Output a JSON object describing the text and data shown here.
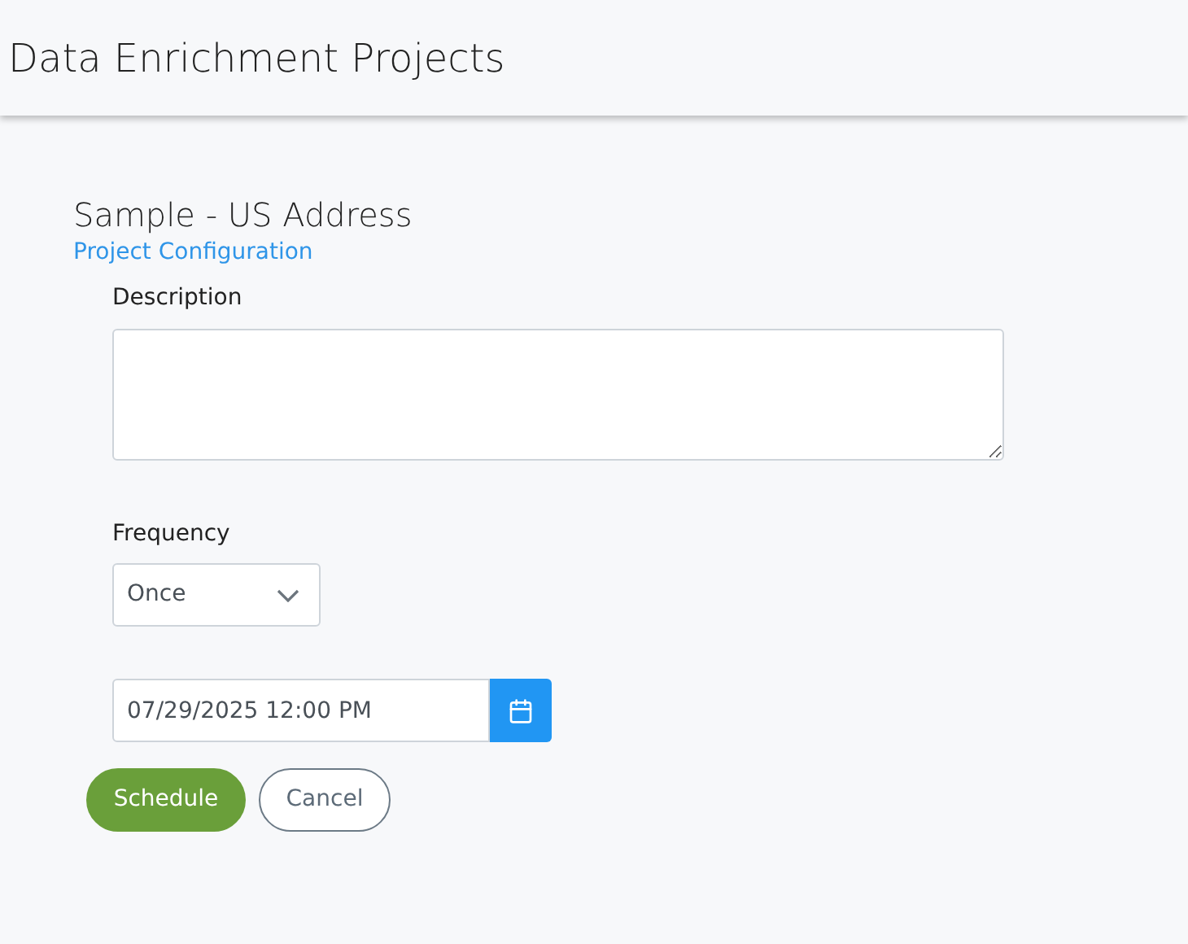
{
  "header": {
    "title": "Data Enrichment Projects"
  },
  "project": {
    "name": "Sample - US Address",
    "link": "Project Configuration"
  },
  "description": {
    "label": "Description"
  },
  "frequency": {
    "label": "Frequency",
    "value": "Once"
  },
  "schedule_time": {
    "value": "07/29/2025 12:00 PM"
  },
  "buttons": [
    {
      "label": "Schedule",
      "kind": "primary"
    },
    {
      "label": "Cancel",
      "kind": "secondary"
    }
  ]
}
